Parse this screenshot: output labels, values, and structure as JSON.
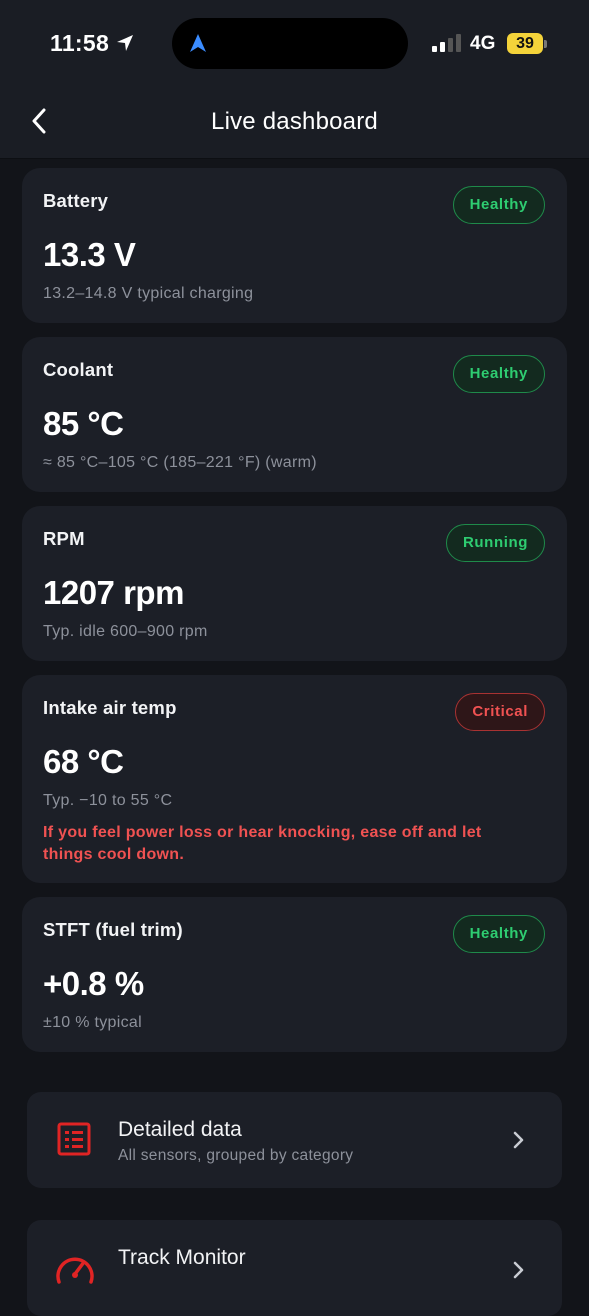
{
  "status_bar": {
    "time": "11:58",
    "network": "4G",
    "battery": "39"
  },
  "header": {
    "title": "Live dashboard"
  },
  "metrics": [
    {
      "title": "Battery",
      "value": "13.3 V",
      "subtitle": "13.2–14.8 V typical charging",
      "status": "Healthy"
    },
    {
      "title": "Coolant",
      "value": "85 °C",
      "subtitle": "≈ 85 °C–105 °C (185–221 °F) (warm)",
      "status": "Healthy"
    },
    {
      "title": "RPM",
      "value": "1207 rpm",
      "subtitle": "Typ. idle 600–900 rpm",
      "status": "Running"
    },
    {
      "title": "Intake air temp",
      "value": "68 °C",
      "subtitle": "Typ. −10 to 55 °C",
      "status": "Critical",
      "warning": "If you feel power loss or hear knocking, ease off and let things cool down."
    },
    {
      "title": "STFT (fuel trim)",
      "value": "+0.8 %",
      "subtitle": "±10 % typical",
      "status": "Healthy"
    }
  ],
  "links": [
    {
      "title": "Detailed data",
      "subtitle": "All sensors, grouped by category",
      "icon": "list-icon"
    },
    {
      "title": "Track Monitor",
      "subtitle": "",
      "icon": "speedometer-icon"
    }
  ],
  "colors": {
    "background": "#121419",
    "card": "#1c1f27",
    "healthy": "#2ecc71",
    "critical": "#f05252",
    "accent_red": "#e02424"
  }
}
